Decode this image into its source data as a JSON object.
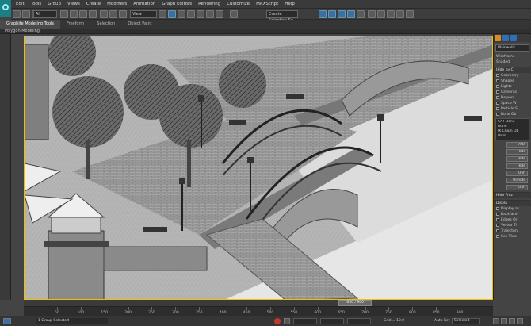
{
  "menu": [
    "Edit",
    "Tools",
    "Group",
    "Views",
    "Create",
    "Modifiers",
    "Animation",
    "Graph Editors",
    "Rendering",
    "Customize",
    "MAXScript",
    "Help"
  ],
  "toolbar": {
    "selection_filter": "All",
    "reference_coord": "View",
    "named_selection": "Create Selection Se"
  },
  "ribbon": {
    "tabs": [
      "Graphite Modeling Tools",
      "Freeform",
      "Selection",
      "Object Paint"
    ],
    "active_tab": "Graphite Modeling Tools",
    "sub_label": "Polygon Modeling"
  },
  "command_panel": {
    "object_name": "Mainwalls",
    "rows_top": [
      "Wireframe",
      "Shaded"
    ],
    "hide_by_category": "Hide by C",
    "categories": [
      "Geometry",
      "Shapes",
      "Lights",
      "Cameras",
      "Helpers",
      "Space W",
      "Particle S",
      "Bone Ob"
    ],
    "list": [
      "CAT Bone",
      "Bone",
      "IK Chain Ob",
      "Point"
    ],
    "buttons": [
      "Add",
      "Hide",
      "Hide",
      "Hide",
      "Unh",
      "Unhide",
      "Unh"
    ],
    "hide_frozen": "Hide Froz",
    "display_props": "Displa",
    "display_items": [
      "Display as",
      "Backface",
      "Edges Or",
      "Vertex Ti",
      "Trajectory",
      "See-Thro"
    ]
  },
  "timeline": {
    "frame_label": "650 / 900",
    "progress": 0.7222,
    "ticks": [
      "50",
      "100",
      "150",
      "200",
      "250",
      "300",
      "350",
      "400",
      "450",
      "500",
      "550",
      "600",
      "650",
      "700",
      "750",
      "800",
      "850",
      "900"
    ]
  },
  "status": {
    "selection": "1 Group Selected",
    "grid": "Grid = 10.0",
    "auto_key": "Auto Key",
    "key_mode": "Selected"
  }
}
